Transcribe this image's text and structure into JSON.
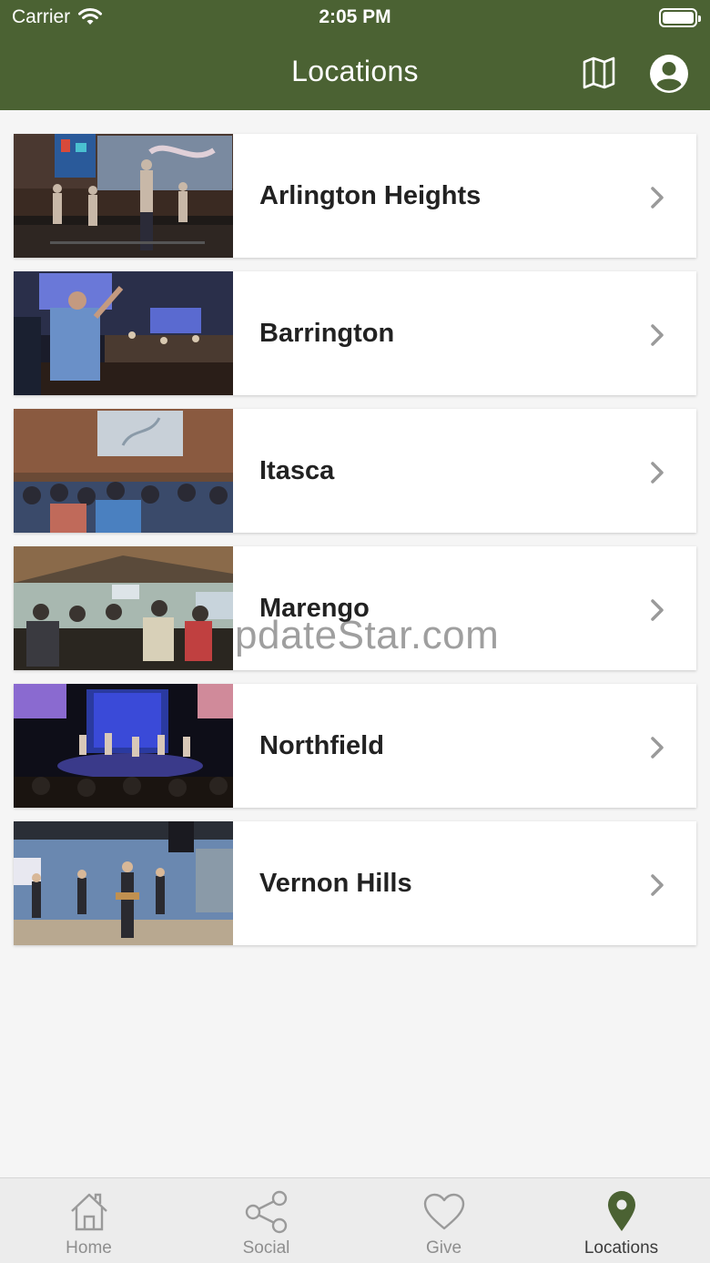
{
  "status_bar": {
    "carrier": "Carrier",
    "time": "2:05 PM",
    "wifi_icon": "wifi-icon",
    "battery_icon": "battery-full-icon"
  },
  "nav": {
    "title": "Locations",
    "map_icon": "map-icon",
    "profile_icon": "user-circle-icon",
    "background_color": "#4b6233"
  },
  "locations": [
    {
      "name": "Arlington Heights"
    },
    {
      "name": "Barrington"
    },
    {
      "name": "Itasca"
    },
    {
      "name": "Marengo"
    },
    {
      "name": "Northfield"
    },
    {
      "name": "Vernon Hills"
    }
  ],
  "watermark": "pdateStar.com",
  "tabbar": {
    "tabs": [
      {
        "label": "Home",
        "icon": "home-icon",
        "active": false
      },
      {
        "label": "Social",
        "icon": "share-icon",
        "active": false
      },
      {
        "label": "Give",
        "icon": "heart-icon",
        "active": false
      },
      {
        "label": "Locations",
        "icon": "location-pin-icon",
        "active": true
      }
    ],
    "active_color": "#4b6233"
  }
}
